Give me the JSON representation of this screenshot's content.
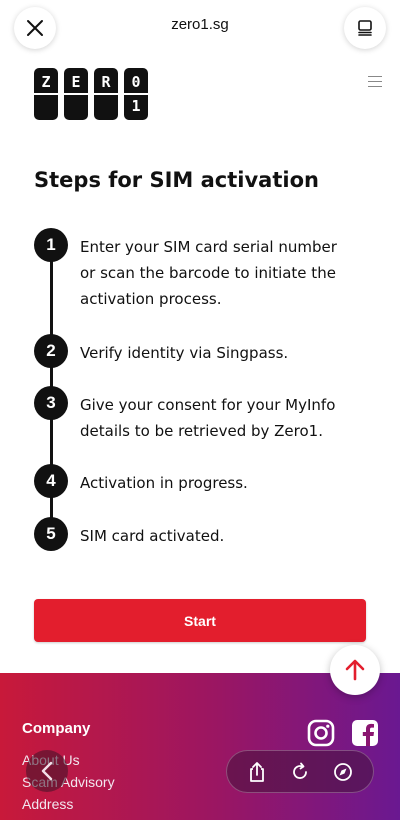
{
  "browser": {
    "url": "zero1.sg",
    "close_icon": "close-icon",
    "tabs_icon": "tabs-icon"
  },
  "logo": {
    "tiles": [
      {
        "top": "Z",
        "bottom": ""
      },
      {
        "top": "E",
        "bottom": ""
      },
      {
        "top": "R",
        "bottom": ""
      },
      {
        "top": "0",
        "bottom": "1"
      }
    ]
  },
  "menu_icon": "hamburger-menu-icon",
  "page": {
    "heading": "Steps for SIM activation",
    "steps": [
      {
        "number": "1",
        "text": "Enter your SIM card serial number or scan the barcode to initiate the activation process."
      },
      {
        "number": "2",
        "text": "Verify identity via Singpass."
      },
      {
        "number": "3",
        "text": "Give your consent for your MyInfo details to be retrieved by Zero1."
      },
      {
        "number": "4",
        "text": "Activation in progress."
      },
      {
        "number": "5",
        "text": "SIM card activated."
      }
    ],
    "start_label": "Start"
  },
  "footer": {
    "title": "Company",
    "links": [
      "About Us",
      "Scam Advisory",
      "Address"
    ],
    "social_icons": [
      "instagram-icon",
      "facebook-icon"
    ]
  },
  "toolbar": {
    "icons": [
      "back-icon",
      "share-icon",
      "reload-icon",
      "compass-icon",
      "scroll-to-top-icon"
    ]
  },
  "colors": {
    "accent": "#e31e2d",
    "footer_gradient_start": "#c8193a",
    "footer_gradient_end": "#6a1891",
    "text": "#111111"
  }
}
